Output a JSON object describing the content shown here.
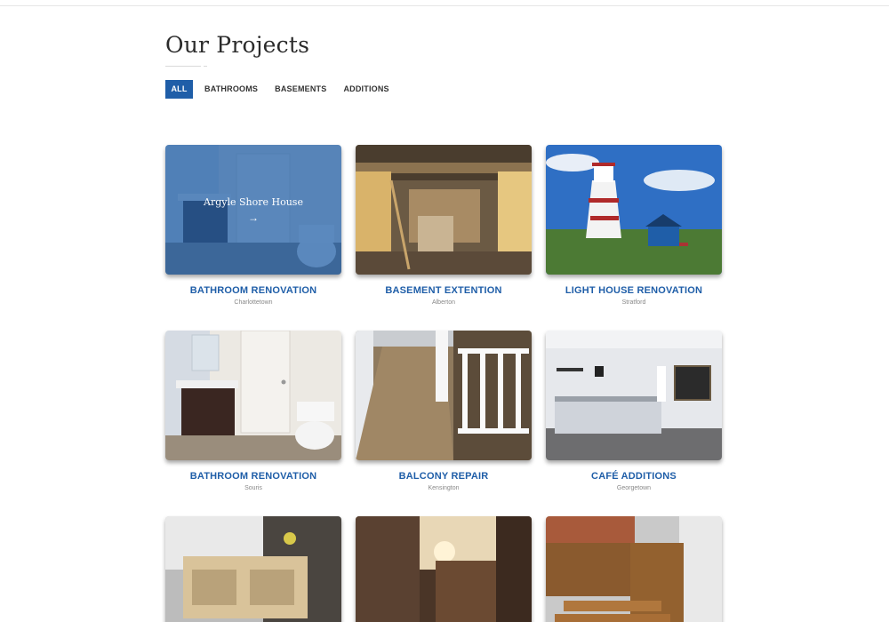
{
  "header": {
    "title": "Our Projects"
  },
  "filters": [
    {
      "label": "ALL",
      "active": true
    },
    {
      "label": "BATHROOMS",
      "active": false
    },
    {
      "label": "BASEMENTS",
      "active": false
    },
    {
      "label": "ADDITIONS",
      "active": false
    }
  ],
  "colors": {
    "accent": "#1f5ea8",
    "title": "#2b2b2b",
    "muted": "#888888"
  },
  "hover_overlay": {
    "title": "Argyle Shore House",
    "arrow": "→"
  },
  "projects": [
    {
      "title": "BATHROOM RENOVATION",
      "location": "Charlottetown",
      "image": "bathroom-photo"
    },
    {
      "title": "BASEMENT EXTENTION",
      "location": "Alberton",
      "image": "basement-photo"
    },
    {
      "title": "LIGHT HOUSE RENOVATION",
      "location": "Stratford",
      "image": "lighthouse-photo"
    },
    {
      "title": "BATHROOM RENOVATION",
      "location": "Souris",
      "image": "bathroom-photo"
    },
    {
      "title": "BALCONY REPAIR",
      "location": "Kensington",
      "image": "balcony-photo"
    },
    {
      "title": "CAFÉ ADDITIONS",
      "location": "Georgetown",
      "image": "cafe-photo"
    },
    {
      "title": "",
      "location": "",
      "image": "garage-woodwork-photo"
    },
    {
      "title": "",
      "location": "",
      "image": "fence-photo"
    },
    {
      "title": "",
      "location": "",
      "image": "deck-stairs-photo"
    }
  ]
}
